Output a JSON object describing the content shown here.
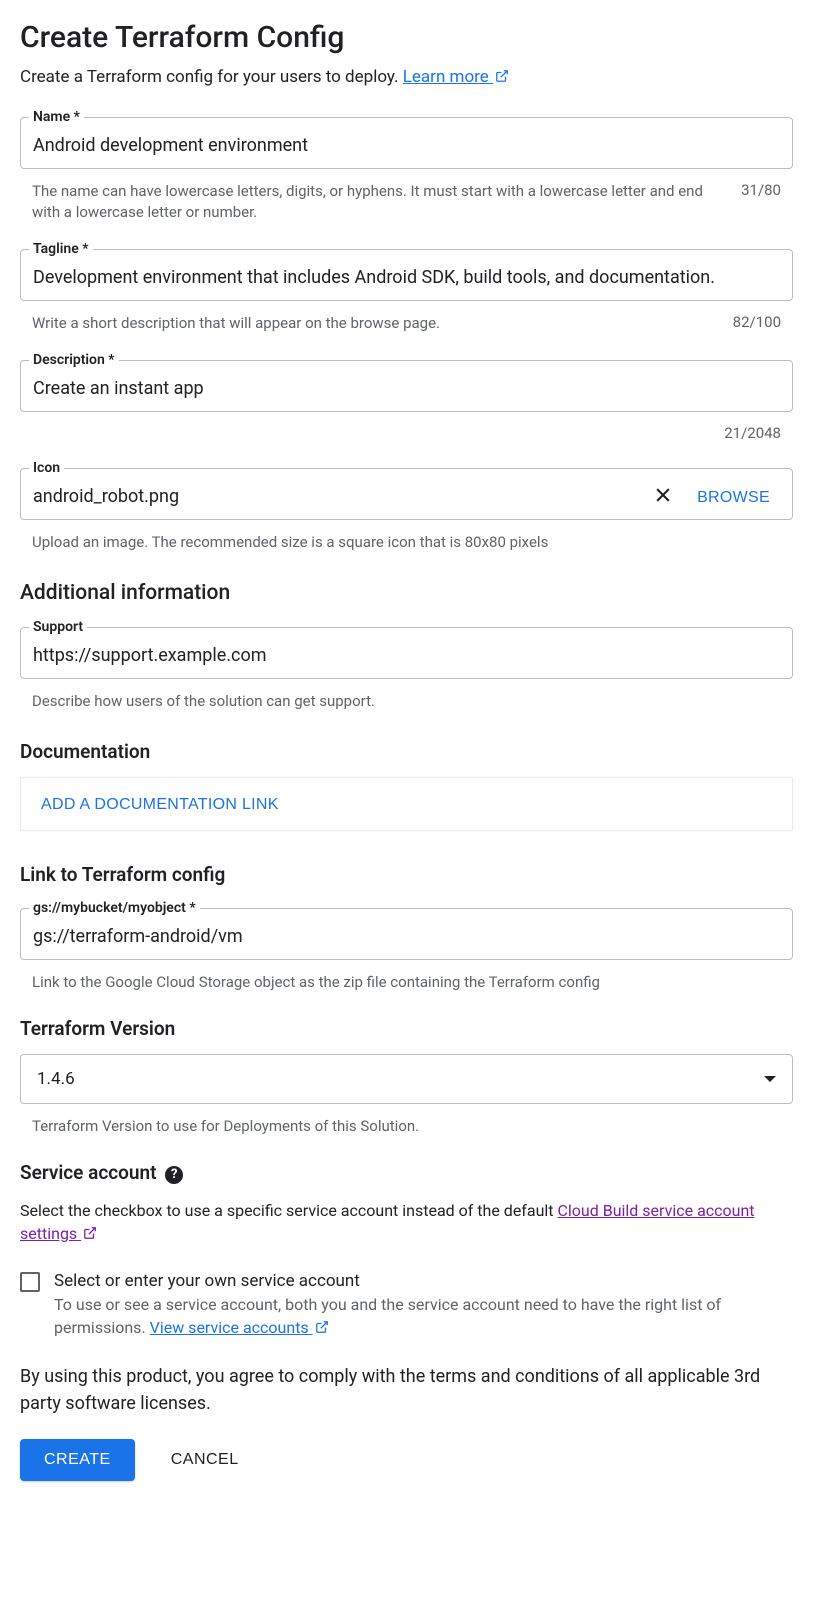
{
  "title": "Create Terraform Config",
  "subtitle_text": "Create a Terraform config for your users to deploy. ",
  "subtitle_link": "Learn more",
  "fields": {
    "name": {
      "label": "Name *",
      "value": "Android development environment",
      "helper": "The name can have lowercase letters, digits, or hyphens. It must start with a lowercase letter and end with a lowercase letter or number.",
      "counter": "31/80"
    },
    "tagline": {
      "label": "Tagline *",
      "value": "Development environment that includes Android SDK, build tools, and documentation.",
      "helper": "Write a short description that will appear on the browse page.",
      "counter": "82/100"
    },
    "description": {
      "label": "Description *",
      "value": "Create an instant app",
      "counter": "21/2048"
    },
    "icon": {
      "label": "Icon",
      "value": "android_robot.png",
      "browse": "BROWSE",
      "helper": "Upload an image. The recommended size is a square icon that is 80x80 pixels"
    },
    "support": {
      "label": "Support",
      "value": "https://support.example.com",
      "helper": "Describe how users of the solution can get support."
    },
    "config_link": {
      "label": "gs://mybucket/myobject *",
      "value": "gs://terraform-android/vm",
      "helper": "Link to the Google Cloud Storage object as the zip file containing the Terraform config"
    },
    "version": {
      "value": "1.4.6",
      "helper": "Terraform Version to use for Deployments of this Solution."
    }
  },
  "sections": {
    "additional": "Additional information",
    "documentation": "Documentation",
    "link_tf": "Link to Terraform config",
    "tf_version": "Terraform Version",
    "service_account": "Service account"
  },
  "doc_button": "ADD A DOCUMENTATION LINK",
  "service_account": {
    "desc_pre": "Select the checkbox to use a specific service account instead of the default ",
    "link": "Cloud Build service account settings",
    "checkbox_label": "Select or enter your own service account",
    "checkbox_desc_pre": "To use or see a service account, both you and the service account need to have the right list of permissions. ",
    "checkbox_link": "View service accounts"
  },
  "agree_text": "By using this product, you agree to comply with the terms and conditions of all applicable 3rd party software licenses.",
  "buttons": {
    "create": "CREATE",
    "cancel": "CANCEL"
  }
}
